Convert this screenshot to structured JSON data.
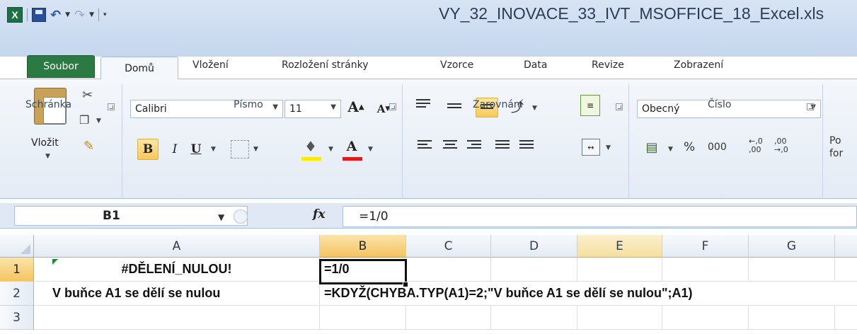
{
  "window": {
    "title": "VY_32_INOVACE_33_IVT_MSOFFICE_18_Excel.xls"
  },
  "qat": {
    "app_icon": "excel-icon",
    "save_icon": "save-icon",
    "undo_icon": "undo-icon",
    "redo_icon": "redo-icon"
  },
  "tabs": {
    "file": "Soubor",
    "items": [
      "Domů",
      "Vložení",
      "Rozložení stránky",
      "Vzorce",
      "Data",
      "Revize",
      "Zobrazení"
    ]
  },
  "ribbon": {
    "clipboard": {
      "paste_label": "Vložit",
      "group_label": "Schránka"
    },
    "font": {
      "font_name": "Calibri",
      "font_size": "11",
      "bold": "B",
      "italic": "I",
      "underline": "U",
      "grow": "A",
      "shrink": "A",
      "font_color_letter": "A",
      "group_label": "Písmo"
    },
    "alignment": {
      "group_label": "Zarovnání"
    },
    "number": {
      "format": "Obecný",
      "percent": "%",
      "thousands": "000",
      "inc_decimal": "←,0 ,00",
      "dec_decimal": ",00 →,0",
      "group_label": "Číslo"
    },
    "styles_partial": "Po\nfor"
  },
  "formula_bar": {
    "name_box": "B1",
    "fx": "fx",
    "formula": "=1/0"
  },
  "grid": {
    "columns": [
      "A",
      "B",
      "C",
      "D",
      "E",
      "F",
      "G"
    ],
    "rows": [
      "1",
      "2",
      "3"
    ],
    "cells": {
      "A1": "#DĚLENÍ_NULOU!",
      "B1": "=1/0",
      "A2": "V buňce A1 se dělí se nulou",
      "B2": "=KDYŽ(CHYBA.TYP(A1)=2;\"V buňce A1 se dělí se nulou\";A1)"
    }
  },
  "colors": {
    "file_tab": "#2b7a43",
    "selection": "#f5c560",
    "ribbon_bg": "#e3ebf5"
  }
}
